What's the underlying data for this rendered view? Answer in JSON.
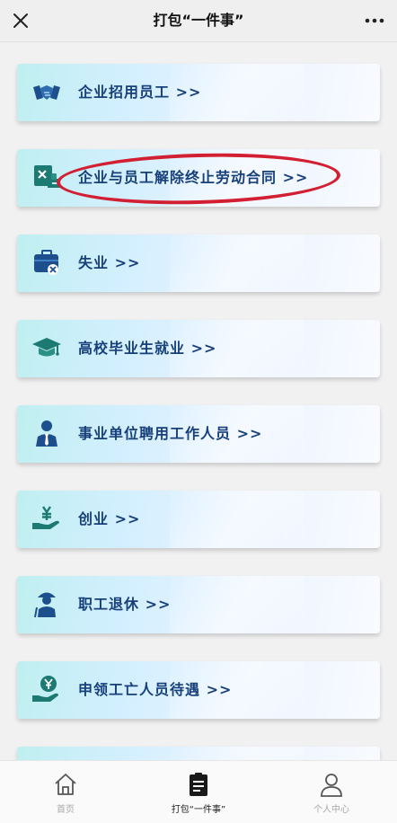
{
  "header": {
    "title": "打包“一件事”",
    "close_icon": "close-icon",
    "more_icon": "more-icon"
  },
  "items": [
    {
      "label": "企业招用员工 >>",
      "icon": "handshake-icon"
    },
    {
      "label": "企业与员工解除终止劳动合同 >>",
      "icon": "contract-termination-icon",
      "highlighted": true
    },
    {
      "label": "失业 >>",
      "icon": "briefcase-icon"
    },
    {
      "label": "高校毕业生就业 >>",
      "icon": "graduation-cap-icon"
    },
    {
      "label": "事业单位聘用工作人员 >>",
      "icon": "staff-person-icon"
    },
    {
      "label": "创业 >>",
      "icon": "money-hand-icon"
    },
    {
      "label": "职工退休 >>",
      "icon": "retiree-icon"
    },
    {
      "label": "申领工亡人员待遇 >>",
      "icon": "benefit-coin-icon"
    }
  ],
  "highlight_color": "#d21f31",
  "tabbar": {
    "tabs": [
      {
        "label": "首页",
        "icon": "home-icon"
      },
      {
        "label": "打包“一件事”",
        "icon": "clipboard-icon",
        "active": true
      },
      {
        "label": "个人中心",
        "icon": "user-icon"
      }
    ]
  }
}
